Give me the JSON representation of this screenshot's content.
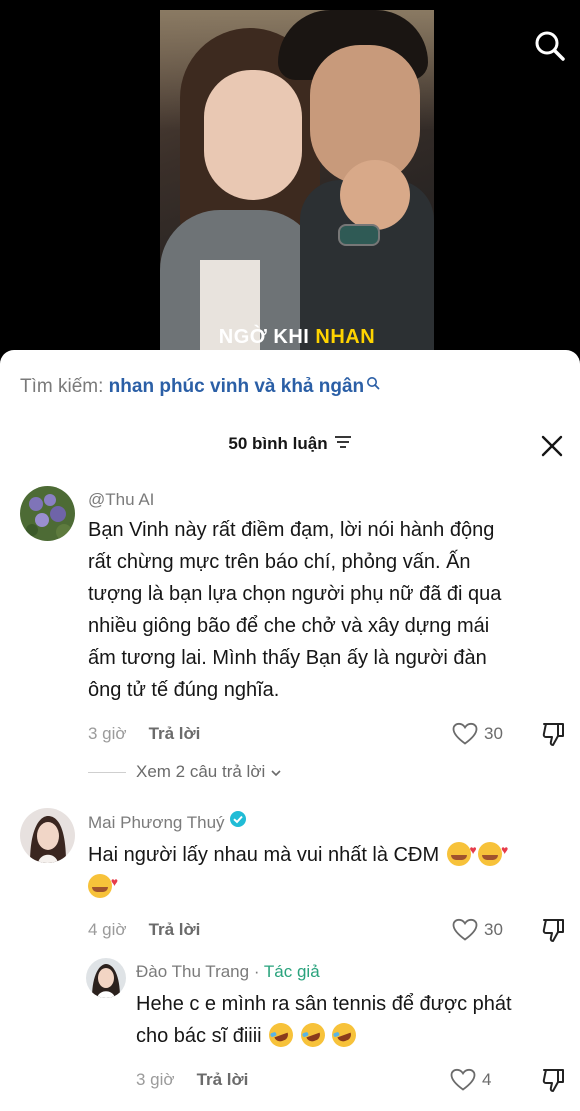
{
  "video": {
    "caption_white": "NGỜ KHI",
    "caption_yellow": "NHAN"
  },
  "search": {
    "label": "Tìm kiếm:",
    "query": "nhan phúc vinh và khả ngân"
  },
  "comments_header": {
    "count_label": "50 bình luận"
  },
  "comments": [
    {
      "username": "@Thu AI",
      "lines": [
        "Bạn Vinh này rất điềm đạm, lời nói hành động",
        "rất chừng mực trên báo chí, phỏng vấn. Ấn",
        "tượng là bạn lựa chọn người phụ nữ đã đi qua",
        "nhiều giông bão để che chở và xây dựng mái",
        "ấm tương lai. Mình thấy Bạn ấy là người đàn",
        "ông tử tế đúng nghĩa."
      ],
      "time": "3 giờ",
      "reply_label": "Trả lời",
      "likes": "30",
      "view_replies": "Xem 2 câu trả lời"
    },
    {
      "username": "Mai Phương Thuý",
      "lines": [
        "Hai người lấy nhau mà vui nhất là CĐM"
      ],
      "time": "4 giờ",
      "reply_label": "Trả lời",
      "likes": "30"
    },
    {
      "username": "Đào Thu Trang",
      "separator": " · ",
      "author_tag": "Tác giả",
      "lines": [
        "Hehe c e mình ra sân tennis để được phát",
        "cho bác sĩ điiii"
      ],
      "time": "3 giờ",
      "reply_label": "Trả lời",
      "likes": "4"
    }
  ],
  "icons": {
    "top_search": "search-icon",
    "query_search": "search-icon",
    "filter": "filter-icon",
    "close": "close-icon",
    "like": "heart-icon",
    "dislike": "thumbs-down-icon",
    "verified": "verified-badge-icon",
    "expand": "chevron-down-icon"
  },
  "colors": {
    "query_link": "#2b5fa6",
    "author_tag": "#2aa37d",
    "verified": "#20bcd6",
    "caption_yellow": "#ffd400"
  }
}
